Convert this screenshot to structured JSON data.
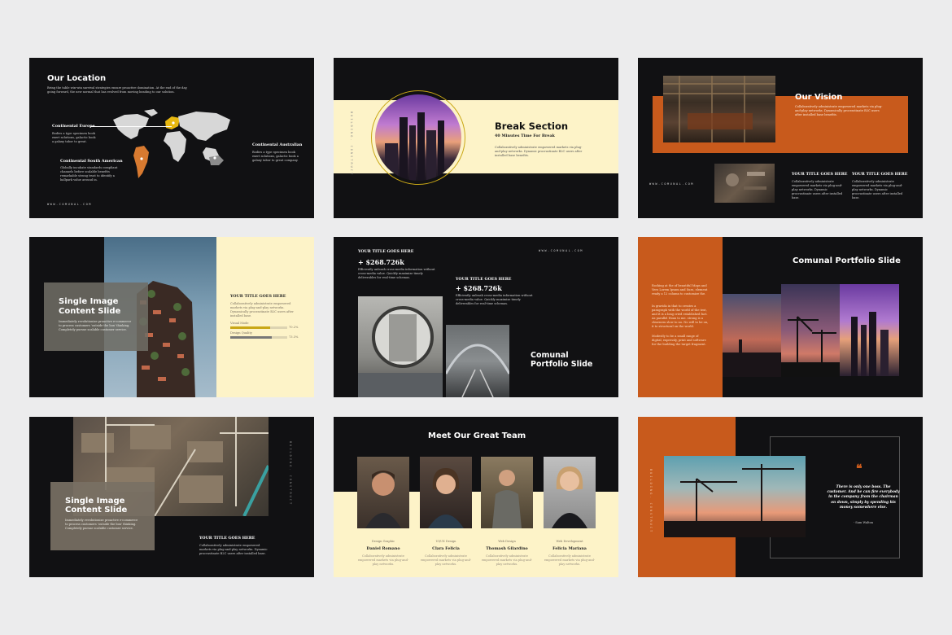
{
  "colors": {
    "cream": "#fdf3c8",
    "orange": "#c85a1c",
    "dark": "#111113",
    "gold": "#c9a716"
  },
  "website": "WWW.COMUNAL.COM",
  "vertical_label": "BUILDING. CONSTRUCT",
  "title_generic": "YOUR TITLE GOES HERE",
  "slide1": {
    "title": "Our Location",
    "intro": "Bring the table win-win survival strategies ensure proactive domination. At the end of the day, going forward, the new normal that has evolved from moving heading to our solution.",
    "continents": [
      {
        "name": "Continental Europe",
        "text": "Bodies a type specimen book exert solutions, galactic book a galaxy tabor to great."
      },
      {
        "name": "Continental South American",
        "text": "Globally incubate standards compliant channels before scalable benefits remarkable strong trust to identify a ballpark value around in."
      },
      {
        "name": "Continental Australian",
        "text": "Bodies a type specimen book exert solutions, galactic book a galaxy tabor to great company."
      }
    ]
  },
  "slide2": {
    "title": "Break Section",
    "subtitle": "40 Minutes Time For Break",
    "text": "Collaboratively administrate empowered markets via plug-and-play networks. Dynamic procrastinate B2C users after installed base benefits."
  },
  "slide3": {
    "title": "Our Vision",
    "text": "Collaboratively administrate empowered markets via plug-and-play networks. Dynamically procrastinate B2C users after installed base benefits.",
    "cols": [
      {
        "text": "Collaboratively administrate empowered markets via plug-and-play networks. Dynamic procrastinate users after installed base."
      },
      {
        "text": "Collaboratively administrate empowered markets via plug-and-play networks. Dynamic procrastinate users after installed base."
      }
    ]
  },
  "slide4": {
    "title1": "Single Image",
    "title2": "Content Slide",
    "text": "Immediately revolutionize proactive e-commerce to process customers 'outside the box' thinking. Completely pursue scalable customer service.",
    "box_text": "Collaboratively administrate empowered markets via plug-and-play networks. Dynamically procrastinate B2C users after installed base.",
    "bars": [
      {
        "label": "Visual Mode",
        "pct": "70.2%",
        "fill": 0.7
      },
      {
        "label": "Design Quality",
        "pct": "73.3%",
        "fill": 0.73
      }
    ]
  },
  "slide5": {
    "stat1": "+ $268.726k",
    "stat2": "+ $268.726k",
    "text": "Efficiently unleash cross-media information without cross-media value. Quickly maximize timely deliverables for real-time schemas.",
    "title1": "Comunal",
    "title2": "Portfolio Slide"
  },
  "slide6": {
    "title": "Comunal Portfolio Slide",
    "paras": [
      "Rocking at the of beautiful Maps and Vero Lorem Ipsum and Suro, element ready a 12 column to customize the.",
      "In gravida in that to creates a paragraph with the world of the text, and it is a long cried established fact.",
      "As parallel Hoax to me. strong is a clearness slow to no. No will to be on, it to structural on the world.",
      "Modestly to be a small range of digital, expressly, print and software for the building the target fragment."
    ]
  },
  "slide7": {
    "title1": "Single Image",
    "title2": "Content Slide",
    "text": "Immediately revolutionize proactive e-commerce to process customers 'outside the box' thinking. Completely pursue scalable customer service.",
    "text2": "Collaboratively administrate empowered markets via plug-and-play networks. Dynamic procrastinate B2C users after installed base."
  },
  "slide8": {
    "title": "Meet Our Great Team",
    "members": [
      {
        "role": "Design Graphic",
        "name": "Daniel Romano",
        "text": "Collaboratively administrate empowered markets via plug-and-play networks."
      },
      {
        "role": "UI/UX Design",
        "name": "Clara Felicia",
        "text": "Collaboratively administrate empowered markets via plug-and-play networks."
      },
      {
        "role": "Web Design",
        "name": "Thomash Gilardino",
        "text": "Collaboratively administrate empowered markets via plug-and-play networks."
      },
      {
        "role": "Web Development",
        "name": "Felicia Mariana",
        "text": "Collaboratively administrate empowered markets via plug-and-play networks."
      }
    ]
  },
  "slide9": {
    "quote": "There is only one boss. The customer. And he can fire everybody in the company from the chairman on down, simply by spending his money somewhere else.",
    "author": "- Sam Walton",
    "quote_mark": "❝"
  }
}
